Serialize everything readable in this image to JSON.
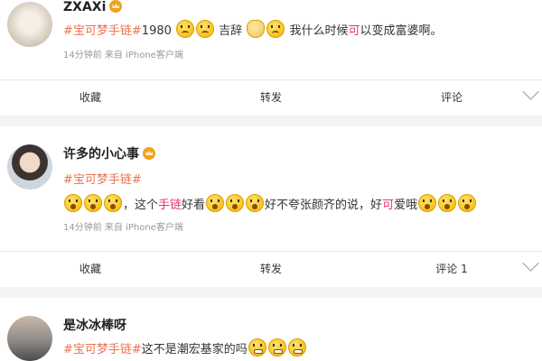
{
  "posts": [
    {
      "username": "ZXAXi",
      "tag": "#宝可梦手链#",
      "text_parts": [
        "1980",
        "吉辞",
        "我什么时候",
        "可",
        "以变成富婆啊。"
      ],
      "meta": "14分钟前   来自 iPhone客户端",
      "actions": [
        "收藏",
        "转发",
        "评论"
      ]
    },
    {
      "username": "许多的小心事",
      "tag": "#宝可梦手链#",
      "text_parts": [
        "，这个",
        "手链",
        "好看",
        "好不夸张颜齐的说，好",
        "可",
        "爱哦"
      ],
      "meta": "14分钟前   来自 iPhone客户端",
      "actions": [
        "收藏",
        "转发",
        "评论 1"
      ]
    },
    {
      "username": "是冰冰棒呀",
      "tag": "#宝可梦手链#",
      "text_parts": [
        "这不是潮宏基家的吗"
      ]
    }
  ],
  "colors": {
    "tag": "#eb7350",
    "highlight": "#e9356d",
    "background": "#f4f4f4"
  },
  "icons": [
    "crown-badge-icon",
    "worried-emoji-icon",
    "clap-emoji-icon",
    "shock-emoji-icon",
    "silent-emoji-icon",
    "chevron-down-icon"
  ]
}
